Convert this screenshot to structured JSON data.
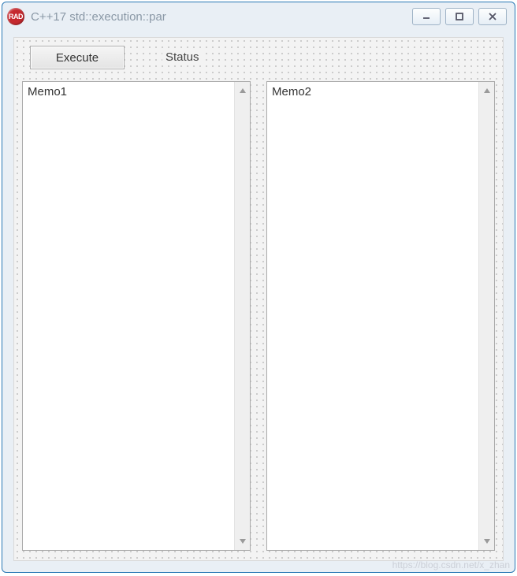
{
  "window": {
    "title": "C++17 std::execution::par",
    "icon_label": "RAD"
  },
  "toolbar": {
    "execute_label": "Execute",
    "status_label": "Status"
  },
  "memos": {
    "memo1": {
      "text": "Memo1"
    },
    "memo2": {
      "text": "Memo2"
    }
  },
  "watermark": "https://blog.csdn.net/x_zhan"
}
